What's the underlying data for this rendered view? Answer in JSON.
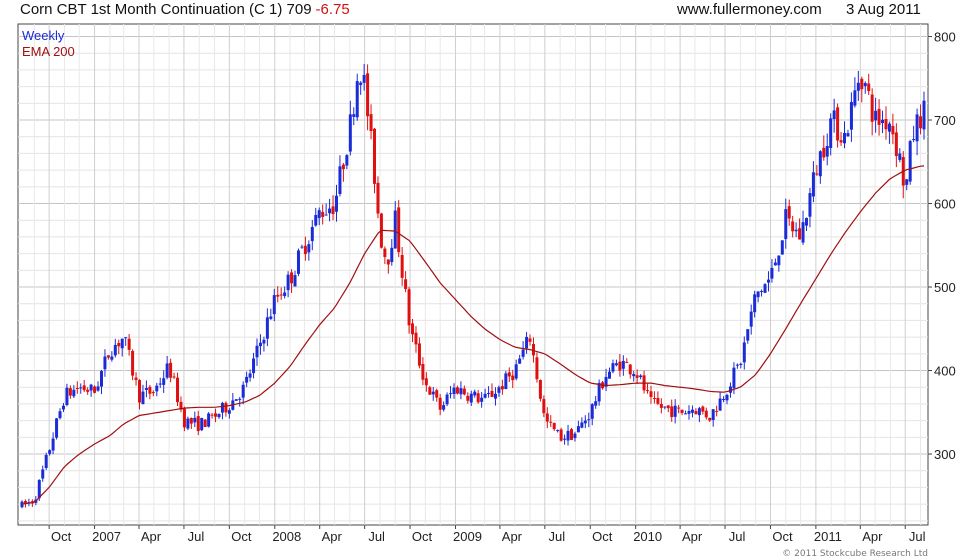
{
  "header": {
    "title": "Corn CBT 1st Month Continuation (C 1) 709",
    "change": "-6.75",
    "site": "www.fullermoney.com",
    "date": "3 Aug 2011"
  },
  "colors": {
    "up": "#1a2bd8",
    "down": "#e01010",
    "ema": "#a01010",
    "grid": "#d8d8d8",
    "frame": "#444444",
    "weekly_label": "#1a2bd8"
  },
  "copyright": "© 2011 Stockcube Research Ltd",
  "chart_data": {
    "type": "candlestick",
    "title": "Corn CBT 1st Month Continuation (C 1) 709",
    "frequency_label": "Weekly",
    "legend": [
      "Weekly",
      "EMA 200"
    ],
    "legend_placement": "top-left",
    "y_axis_position": "right",
    "ylim": [
      215,
      815
    ],
    "y_ticks": [
      300,
      400,
      500,
      600,
      700,
      800
    ],
    "x_ticks": [
      "Oct",
      "2007",
      "Apr",
      "Jul",
      "Oct",
      "2008",
      "Apr",
      "Jul",
      "Oct",
      "2009",
      "Apr",
      "Jul",
      "Oct",
      "2010",
      "Apr",
      "Jul",
      "Oct",
      "2011",
      "Apr",
      "Jul"
    ],
    "x_range": [
      "2006-08-07",
      "2011-08-08"
    ],
    "grid": true,
    "price_anchors": [
      [
        "2006-08-07",
        238
      ],
      [
        "2006-09-01",
        245
      ],
      [
        "2006-10-01",
        305
      ],
      [
        "2006-11-01",
        370
      ],
      [
        "2006-12-01",
        380
      ],
      [
        "2007-01-01",
        375
      ],
      [
        "2007-02-01",
        425
      ],
      [
        "2007-03-01",
        440
      ],
      [
        "2007-04-01",
        370
      ],
      [
        "2007-05-01",
        375
      ],
      [
        "2007-06-01",
        405
      ],
      [
        "2007-07-01",
        340
      ],
      [
        "2007-08-01",
        335
      ],
      [
        "2007-09-01",
        345
      ],
      [
        "2007-10-01",
        360
      ],
      [
        "2007-11-01",
        380
      ],
      [
        "2007-12-01",
        430
      ],
      [
        "2008-01-01",
        485
      ],
      [
        "2008-02-01",
        510
      ],
      [
        "2008-03-01",
        550
      ],
      [
        "2008-04-01",
        590
      ],
      [
        "2008-05-01",
        600
      ],
      [
        "2008-06-01",
        690
      ],
      [
        "2008-06-20",
        770
      ],
      [
        "2008-07-01",
        740
      ],
      [
        "2008-07-20",
        640
      ],
      [
        "2008-08-01",
        565
      ],
      [
        "2008-08-15",
        530
      ],
      [
        "2008-09-01",
        580
      ],
      [
        "2008-10-01",
        450
      ],
      [
        "2008-11-01",
        385
      ],
      [
        "2008-12-01",
        355
      ],
      [
        "2009-01-01",
        380
      ],
      [
        "2009-02-01",
        370
      ],
      [
        "2009-03-01",
        365
      ],
      [
        "2009-04-01",
        380
      ],
      [
        "2009-05-01",
        400
      ],
      [
        "2009-06-01",
        440
      ],
      [
        "2009-07-01",
        340
      ],
      [
        "2009-08-01",
        320
      ],
      [
        "2009-09-01",
        325
      ],
      [
        "2009-10-01",
        350
      ],
      [
        "2009-11-01",
        395
      ],
      [
        "2009-12-01",
        410
      ],
      [
        "2010-01-01",
        400
      ],
      [
        "2010-02-01",
        360
      ],
      [
        "2010-03-01",
        355
      ],
      [
        "2010-04-01",
        350
      ],
      [
        "2010-05-01",
        355
      ],
      [
        "2010-06-01",
        345
      ],
      [
        "2010-07-01",
        375
      ],
      [
        "2010-08-01",
        410
      ],
      [
        "2010-09-01",
        490
      ],
      [
        "2010-10-01",
        510
      ],
      [
        "2010-11-01",
        580
      ],
      [
        "2010-12-01",
        560
      ],
      [
        "2011-01-01",
        640
      ],
      [
        "2011-02-01",
        700
      ],
      [
        "2011-03-01",
        680
      ],
      [
        "2011-04-01",
        760
      ],
      [
        "2011-05-01",
        700
      ],
      [
        "2011-06-01",
        700
      ],
      [
        "2011-06-25",
        640
      ],
      [
        "2011-07-01",
        610
      ],
      [
        "2011-07-15",
        680
      ],
      [
        "2011-08-03",
        709
      ]
    ],
    "ema200_anchors": [
      [
        "2006-08-07",
        240
      ],
      [
        "2006-09-01",
        242
      ],
      [
        "2006-10-01",
        260
      ],
      [
        "2006-11-01",
        285
      ],
      [
        "2006-12-01",
        300
      ],
      [
        "2007-01-01",
        312
      ],
      [
        "2007-02-01",
        322
      ],
      [
        "2007-03-01",
        336
      ],
      [
        "2007-04-01",
        346
      ],
      [
        "2007-05-01",
        349
      ],
      [
        "2007-06-01",
        352
      ],
      [
        "2007-07-01",
        355
      ],
      [
        "2007-08-01",
        356
      ],
      [
        "2007-09-01",
        356
      ],
      [
        "2007-10-01",
        358
      ],
      [
        "2007-11-01",
        362
      ],
      [
        "2007-12-01",
        370
      ],
      [
        "2008-01-01",
        385
      ],
      [
        "2008-02-01",
        405
      ],
      [
        "2008-03-01",
        430
      ],
      [
        "2008-04-01",
        455
      ],
      [
        "2008-05-01",
        475
      ],
      [
        "2008-06-01",
        505
      ],
      [
        "2008-07-01",
        540
      ],
      [
        "2008-08-01",
        568
      ],
      [
        "2008-09-01",
        567
      ],
      [
        "2008-10-01",
        555
      ],
      [
        "2008-11-01",
        530
      ],
      [
        "2008-12-01",
        505
      ],
      [
        "2009-01-01",
        485
      ],
      [
        "2009-02-01",
        465
      ],
      [
        "2009-03-01",
        450
      ],
      [
        "2009-04-01",
        437
      ],
      [
        "2009-05-01",
        428
      ],
      [
        "2009-06-01",
        425
      ],
      [
        "2009-07-01",
        420
      ],
      [
        "2009-08-01",
        408
      ],
      [
        "2009-09-01",
        395
      ],
      [
        "2009-10-01",
        385
      ],
      [
        "2009-11-01",
        382
      ],
      [
        "2009-12-01",
        383
      ],
      [
        "2010-01-01",
        385
      ],
      [
        "2010-02-01",
        385
      ],
      [
        "2010-03-01",
        382
      ],
      [
        "2010-04-01",
        380
      ],
      [
        "2010-05-01",
        378
      ],
      [
        "2010-06-01",
        375
      ],
      [
        "2010-07-01",
        374
      ],
      [
        "2010-08-01",
        380
      ],
      [
        "2010-09-01",
        395
      ],
      [
        "2010-10-01",
        420
      ],
      [
        "2010-11-01",
        450
      ],
      [
        "2010-12-01",
        480
      ],
      [
        "2011-01-01",
        510
      ],
      [
        "2011-02-01",
        540
      ],
      [
        "2011-03-01",
        565
      ],
      [
        "2011-04-01",
        590
      ],
      [
        "2011-05-01",
        612
      ],
      [
        "2011-06-01",
        630
      ],
      [
        "2011-07-01",
        640
      ],
      [
        "2011-08-03",
        645
      ]
    ]
  }
}
